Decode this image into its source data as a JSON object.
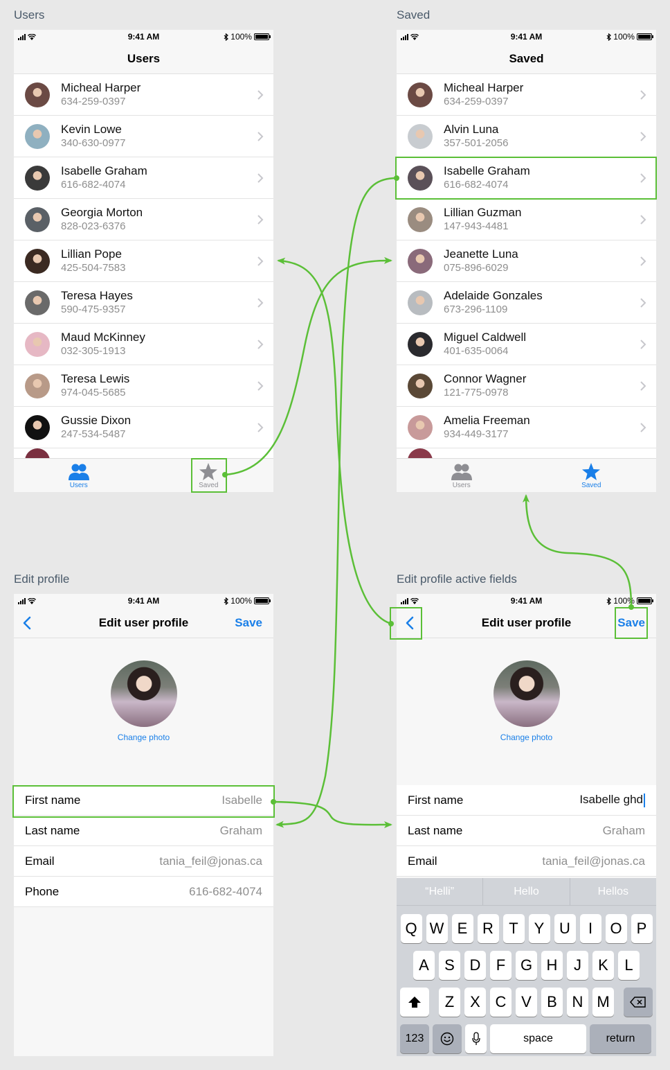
{
  "labels": {
    "users": "Users",
    "saved": "Saved",
    "edit": "Edit profile",
    "edit_active": "Edit profile active fields"
  },
  "status": {
    "time": "9:41 AM",
    "battery": "100%"
  },
  "users_screen": {
    "title": "Users",
    "rows": [
      {
        "name": "Micheal Harper",
        "phone": "634-259-0397",
        "color": "#6b4a44"
      },
      {
        "name": "Kevin Lowe",
        "phone": "340-630-0977",
        "color": "#8fb0c0"
      },
      {
        "name": "Isabelle Graham",
        "phone": "616-682-4074",
        "color": "#3a3a3a"
      },
      {
        "name": "Georgia Morton",
        "phone": "828-023-6376",
        "color": "#5a6066"
      },
      {
        "name": "Lillian Pope",
        "phone": "425-504-7583",
        "color": "#3b2a22"
      },
      {
        "name": "Teresa Hayes",
        "phone": "590-475-9357",
        "color": "#6a6a6a"
      },
      {
        "name": "Maud McKinney",
        "phone": "032-305-1913",
        "color": "#e6b8c4"
      },
      {
        "name": "Teresa Lewis",
        "phone": "974-045-5685",
        "color": "#b89a88"
      },
      {
        "name": "Gussie Dixon",
        "phone": "247-534-5487",
        "color": "#111111"
      }
    ]
  },
  "saved_screen": {
    "title": "Saved",
    "rows": [
      {
        "name": "Micheal Harper",
        "phone": "634-259-0397",
        "color": "#6b4a44"
      },
      {
        "name": "Alvin Luna",
        "phone": "357-501-2056",
        "color": "#c8ccd0"
      },
      {
        "name": "Isabelle Graham",
        "phone": "616-682-4074",
        "color": "#5a5058"
      },
      {
        "name": "Lillian Guzman",
        "phone": "147-943-4481",
        "color": "#9a8c80"
      },
      {
        "name": "Jeanette Luna",
        "phone": "075-896-6029",
        "color": "#8a6a7a"
      },
      {
        "name": "Adelaide Gonzales",
        "phone": "673-296-1109",
        "color": "#b8bcc0"
      },
      {
        "name": "Miguel Caldwell",
        "phone": "401-635-0064",
        "color": "#2a2a2e"
      },
      {
        "name": "Connor Wagner",
        "phone": "121-775-0978",
        "color": "#5a4836"
      },
      {
        "name": "Amelia Freeman",
        "phone": "934-449-3177",
        "color": "#c89a9a"
      }
    ]
  },
  "tabs": {
    "users": "Users",
    "saved": "Saved"
  },
  "edit_screen": {
    "title": "Edit user profile",
    "save": "Save",
    "change_photo": "Change photo",
    "fields": [
      {
        "label": "First name",
        "value": "Isabelle"
      },
      {
        "label": "Last name",
        "value": "Graham"
      },
      {
        "label": "Email",
        "value": "tania_feil@jonas.ca"
      },
      {
        "label": "Phone",
        "value": "616-682-4074"
      }
    ]
  },
  "edit_active_screen": {
    "title": "Edit user profile",
    "save": "Save",
    "change_photo": "Change photo",
    "fields": [
      {
        "label": "First name",
        "value": "Isabelle ghd"
      },
      {
        "label": "Last name",
        "value": "Graham"
      },
      {
        "label": "Email",
        "value": "tania_feil@jonas.ca"
      }
    ],
    "suggestions": [
      "“Helli”",
      "Hello",
      "Hellos"
    ]
  },
  "keyboard": {
    "row1": [
      "Q",
      "W",
      "E",
      "R",
      "T",
      "Y",
      "U",
      "I",
      "O",
      "P"
    ],
    "row2": [
      "A",
      "S",
      "D",
      "F",
      "G",
      "H",
      "J",
      "K",
      "L"
    ],
    "row3": [
      "Z",
      "X",
      "C",
      "V",
      "B",
      "N",
      "M"
    ],
    "num": "123",
    "space": "space",
    "return": "return"
  },
  "colors": {
    "accent": "#1a7fe8",
    "highlight": "#5bbf37",
    "inactive": "#8e8e93"
  },
  "icons": [
    "signal-icon",
    "wifi-icon",
    "bluetooth-icon",
    "battery-icon",
    "chevron-right-icon",
    "users-tab-icon",
    "star-icon",
    "back-chevron-icon",
    "shift-icon",
    "delete-icon",
    "emoji-icon",
    "mic-icon"
  ]
}
